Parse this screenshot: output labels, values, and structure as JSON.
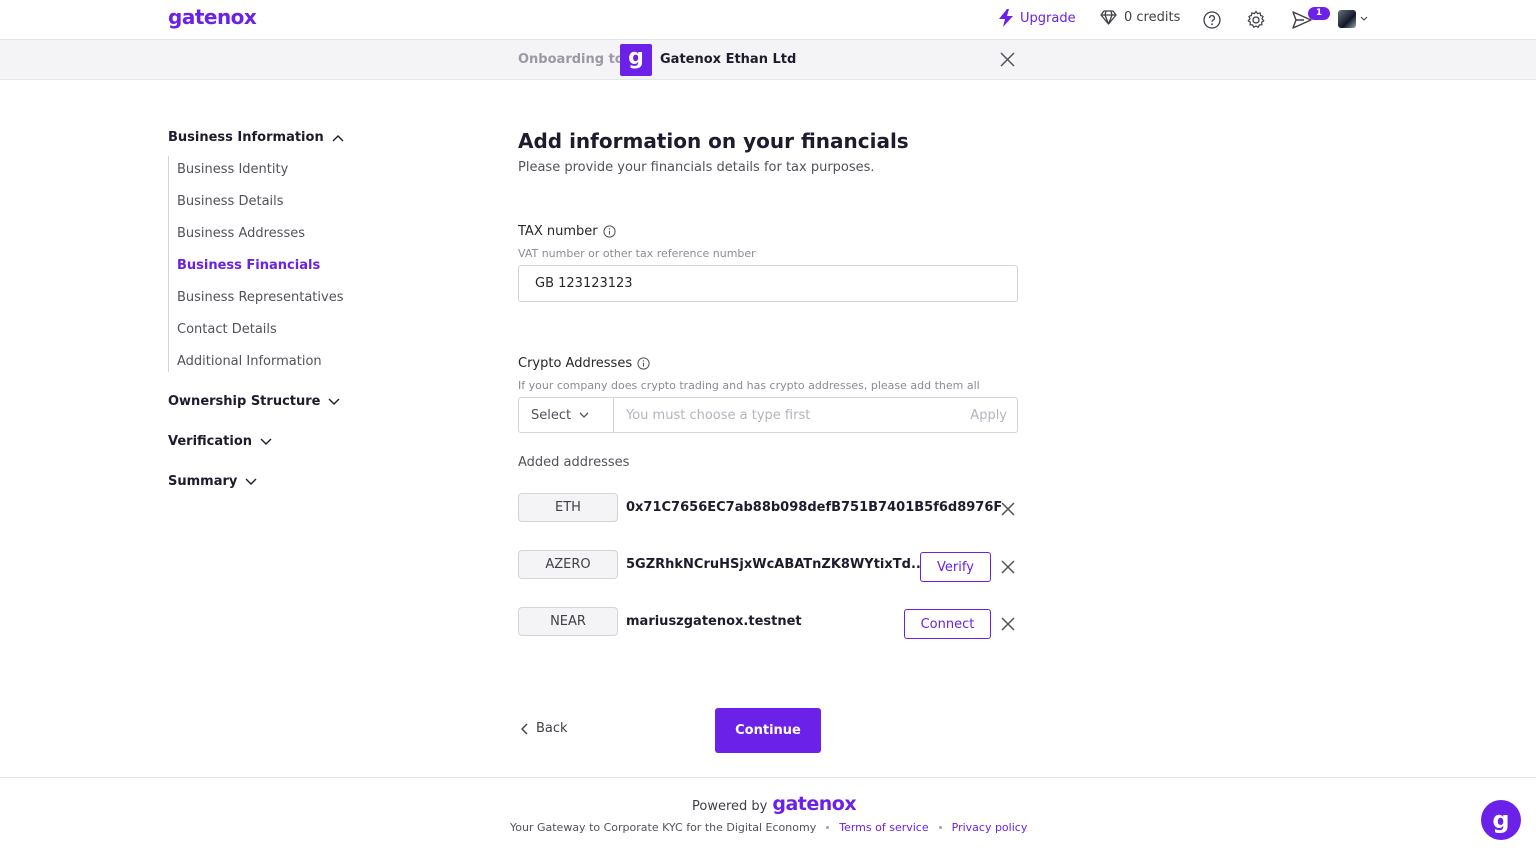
{
  "brand": {
    "logo_text": "gatenox",
    "accent_color": "#6b21e8"
  },
  "topnav": {
    "upgrade_label": "Upgrade",
    "upgrade_icon": "lightning-icon",
    "credits_label": "0 credits",
    "credits_icon": "diamond-icon",
    "help_icon": "help-icon",
    "settings_icon": "gear-icon",
    "notifications_icon": "send-icon",
    "notifications_count": "1"
  },
  "onboarding": {
    "label": "Onboarding to:",
    "company_logo_letter": "g",
    "company_name": "Gatenox Ethan Ltd"
  },
  "sidebar": {
    "groups": [
      {
        "label": "Business Information",
        "expanded": true,
        "items": [
          {
            "label": "Business Identity"
          },
          {
            "label": "Business Details"
          },
          {
            "label": "Business Addresses"
          },
          {
            "label": "Business Financials",
            "active": true
          },
          {
            "label": "Business Representatives"
          },
          {
            "label": "Contact Details"
          },
          {
            "label": "Additional Information"
          }
        ]
      },
      {
        "label": "Ownership Structure",
        "expanded": false
      },
      {
        "label": "Verification",
        "expanded": false
      },
      {
        "label": "Summary",
        "expanded": false
      }
    ]
  },
  "main": {
    "title": "Add information on your financials",
    "subtitle": "Please provide your financials details for tax purposes.",
    "tax": {
      "label": "TAX number",
      "hint": "VAT number or other tax reference number",
      "value": "GB 123123123"
    },
    "crypto": {
      "label": "Crypto Addresses",
      "hint": "If your company does crypto trading and has crypto addresses, please add them all",
      "select_label": "Select",
      "input_placeholder": "You must choose a type first",
      "apply_label": "Apply"
    },
    "added_label": "Added addresses",
    "addresses": [
      {
        "type": "ETH",
        "address": "0x71C7656EC7ab88b098defB751B7401B5f6d8976F",
        "action": ""
      },
      {
        "type": "AZERO",
        "address": "5GZRhkNCruHSjxWcABATnZK8WYtixTd...",
        "action": "Verify"
      },
      {
        "type": "NEAR",
        "address": "mariuszgatenox.testnet",
        "action": "Connect"
      }
    ],
    "back_label": "Back",
    "continue_label": "Continue"
  },
  "footer": {
    "powered_by": "Powered by",
    "brand": "gatenox",
    "tagline": "Your Gateway to Corporate KYC for the Digital Economy",
    "terms": "Terms of service",
    "privacy": "Privacy policy",
    "chat_letter": "g"
  }
}
